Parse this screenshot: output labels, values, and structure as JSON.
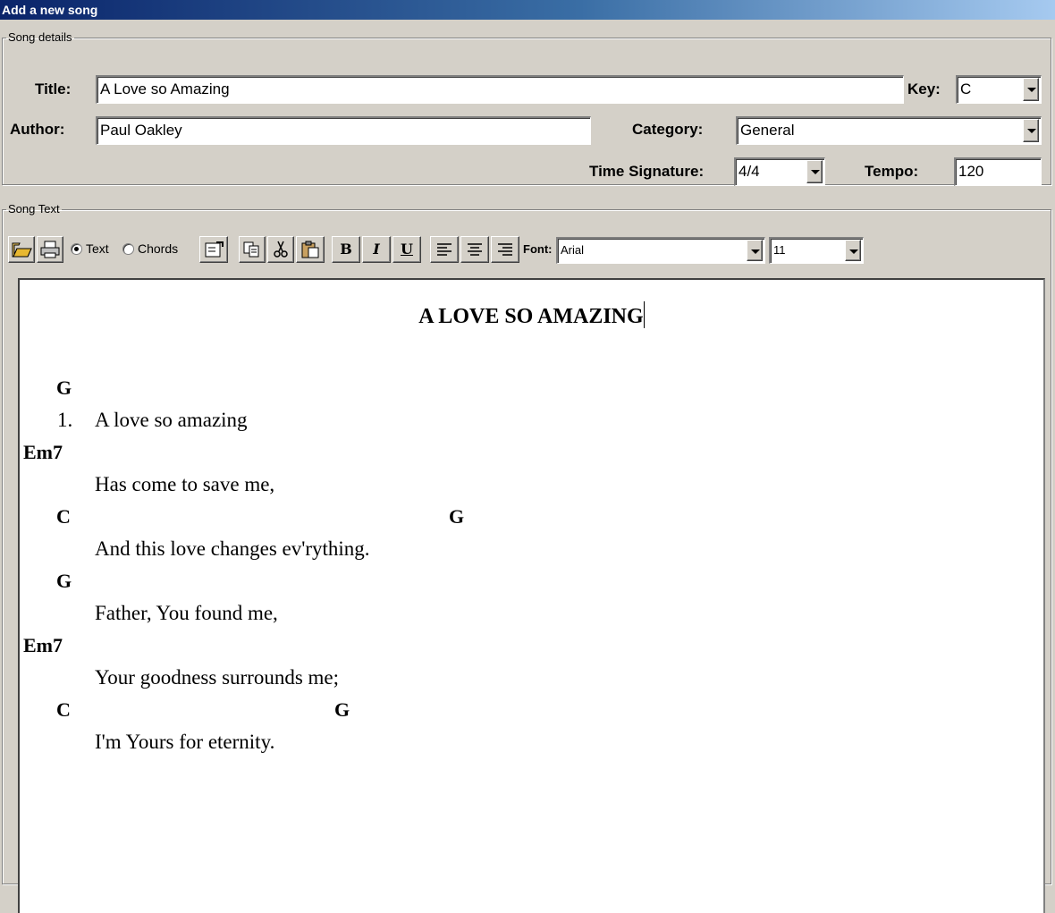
{
  "window": {
    "title": "Add a new song"
  },
  "details": {
    "legend": "Song details",
    "title_label": "Title:",
    "title_value": "A Love so Amazing",
    "key_label": "Key:",
    "key_value": "C",
    "author_label": "Author:",
    "author_value": "Paul Oakley",
    "category_label": "Category:",
    "category_value": "General",
    "time_sig_label": "Time Signature:",
    "time_sig_value": "4/4",
    "tempo_label": "Tempo:",
    "tempo_value": "120"
  },
  "songtext": {
    "legend": "Song Text",
    "toolbar": {
      "open_icon": "folder-open-icon",
      "print_icon": "printer-icon",
      "mode_text_label": "Text",
      "mode_chords_label": "Chords",
      "mode_selected": "Text",
      "properties_icon": "properties-icon",
      "copy_icon": "copy-icon",
      "cut_icon": "scissors-icon",
      "paste_icon": "paste-icon",
      "bold_label": "B",
      "italic_label": "I",
      "underline_label": "U",
      "font_label": "Font:",
      "font_value": "Arial",
      "size_value": "11"
    },
    "doc": {
      "heading": "A LOVE SO AMAZING",
      "lines": [
        {
          "chords": [
            "G"
          ]
        },
        {
          "num": "1.",
          "text": "A love so amazing"
        },
        {
          "chords": [
            "Em7"
          ]
        },
        {
          "text": "Has come to save me,"
        },
        {
          "chords": [
            "C",
            "G"
          ]
        },
        {
          "text": "And this love changes ev'rything."
        },
        {
          "chords": [
            "G"
          ]
        },
        {
          "text": "Father, You found me,"
        },
        {
          "chords": [
            "Em7"
          ]
        },
        {
          "text": "Your goodness surrounds me;"
        },
        {
          "chords": [
            "C",
            "G"
          ]
        },
        {
          "text": "I'm Yours for eternity."
        }
      ]
    }
  }
}
